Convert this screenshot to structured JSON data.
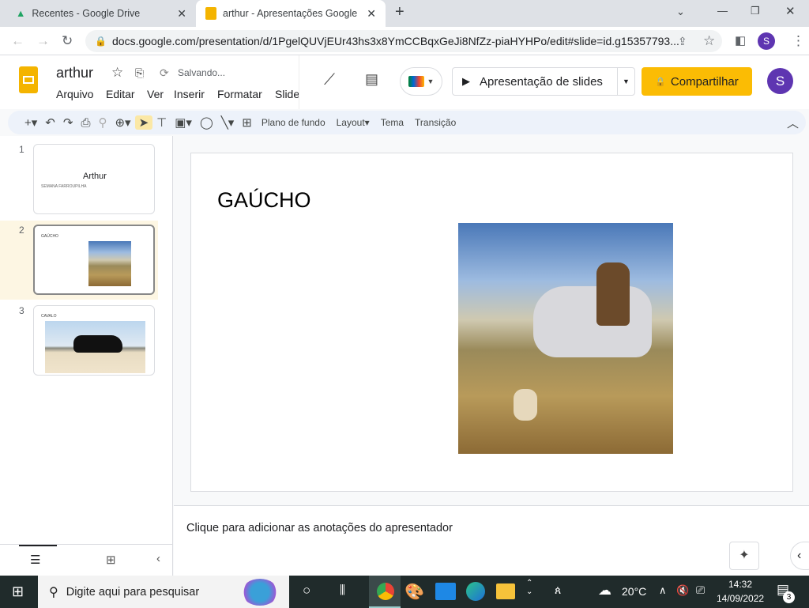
{
  "browser": {
    "tabs": [
      {
        "title": "Recentes - Google Drive",
        "icon": "google-drive-icon"
      },
      {
        "title": "arthur - Apresentações Google",
        "icon": "google-slides-icon"
      }
    ],
    "url": "docs.google.com/presentation/d/1PgelQUVjEUr43hs3x8YmCCBqxGeJi8NfZz-piaHYHPo/edit#slide=id.g15357793...",
    "profile": "S"
  },
  "doc": {
    "title": "arthur",
    "status": "Salvando...",
    "menu": [
      "Arquivo",
      "Editar",
      "Ver",
      "Inserir",
      "Formatar",
      "Slide"
    ],
    "present_label": "Apresentação de slides",
    "share_label": "Compartilhar",
    "avatar": "S",
    "accent": "#fbbc04"
  },
  "toolbar": {
    "background": "Plano de fundo",
    "layout": "Layout",
    "theme": "Tema",
    "transition": "Transição"
  },
  "slides": [
    {
      "number": "1",
      "title": "Arthur",
      "subtitle": "SEMANA FARROUPILHA"
    },
    {
      "number": "2",
      "title": "GAÚCHO",
      "selected": true
    },
    {
      "number": "3",
      "title": "CAVALO"
    }
  ],
  "current_slide": {
    "title": "GAÚCHO"
  },
  "notes": {
    "placeholder": "Clique para adicionar as anotações do apresentador"
  },
  "taskbar": {
    "search_placeholder": "Digite aqui para pesquisar",
    "temperature": "20°C",
    "time": "14:32",
    "date": "14/09/2022",
    "notifications": "3"
  }
}
